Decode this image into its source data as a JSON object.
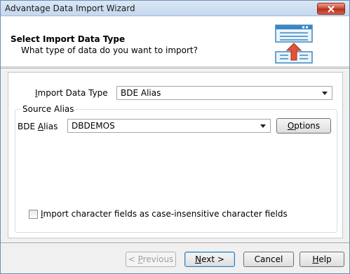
{
  "window": {
    "title": "Advantage Data Import Wizard"
  },
  "header": {
    "title": "Select Import Data Type",
    "subtitle": "What type of data do you want to import?"
  },
  "form": {
    "import_type": {
      "label_accel": "I",
      "label_rest": "mport Data Type",
      "value": "BDE Alias"
    },
    "source_group": {
      "legend": "Source Alias",
      "alias_label_pre": "BDE ",
      "alias_label_accel": "A",
      "alias_label_rest": "lias",
      "alias_value": "DBDEMOS",
      "options_accel": "O",
      "options_rest": "ptions"
    },
    "case_insensitive": {
      "accel": "I",
      "rest": "mport character fields as case-insensitive character fields",
      "checked": false
    }
  },
  "footer": {
    "previous_pre": "< ",
    "previous_accel": "P",
    "previous_rest": "revious",
    "next_accel": "N",
    "next_rest": "ext >",
    "cancel": "Cancel",
    "help_accel": "H",
    "help_rest": "elp"
  },
  "colors": {
    "accent": "#3c7fb1",
    "close": "#c9422d"
  }
}
